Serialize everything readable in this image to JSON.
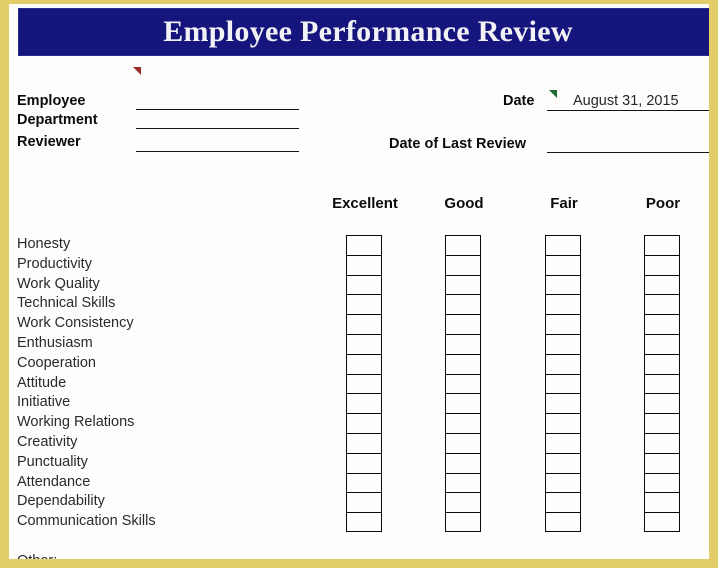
{
  "document": {
    "title": "Employee Performance Review",
    "accent_navy": "#16157e",
    "accent_gold": "#e3cd68"
  },
  "form_fields": {
    "employee_label": "Employee",
    "employee_value": "",
    "department_label": "Department",
    "department_value": "",
    "reviewer_label": "Reviewer",
    "reviewer_value": "",
    "date_label": "Date",
    "date_value": "August 31, 2015",
    "last_review_label": "Date of Last Review",
    "last_review_value": ""
  },
  "rating_headers": [
    "Excellent",
    "Good",
    "Fair",
    "Poor"
  ],
  "criteria": [
    "Honesty",
    "Productivity",
    "Work Quality",
    "Technical Skills",
    "Work Consistency",
    "Enthusiasm",
    "Cooperation",
    "Attitude",
    "Initiative",
    "Working Relations",
    "Creativity",
    "Punctuality",
    "Attendance",
    "Dependability",
    "Communication Skills"
  ],
  "other": {
    "label": "Other:"
  },
  "markers": {
    "employee_comment": "red-comment-marker",
    "date_comment": "green-comment-marker"
  }
}
